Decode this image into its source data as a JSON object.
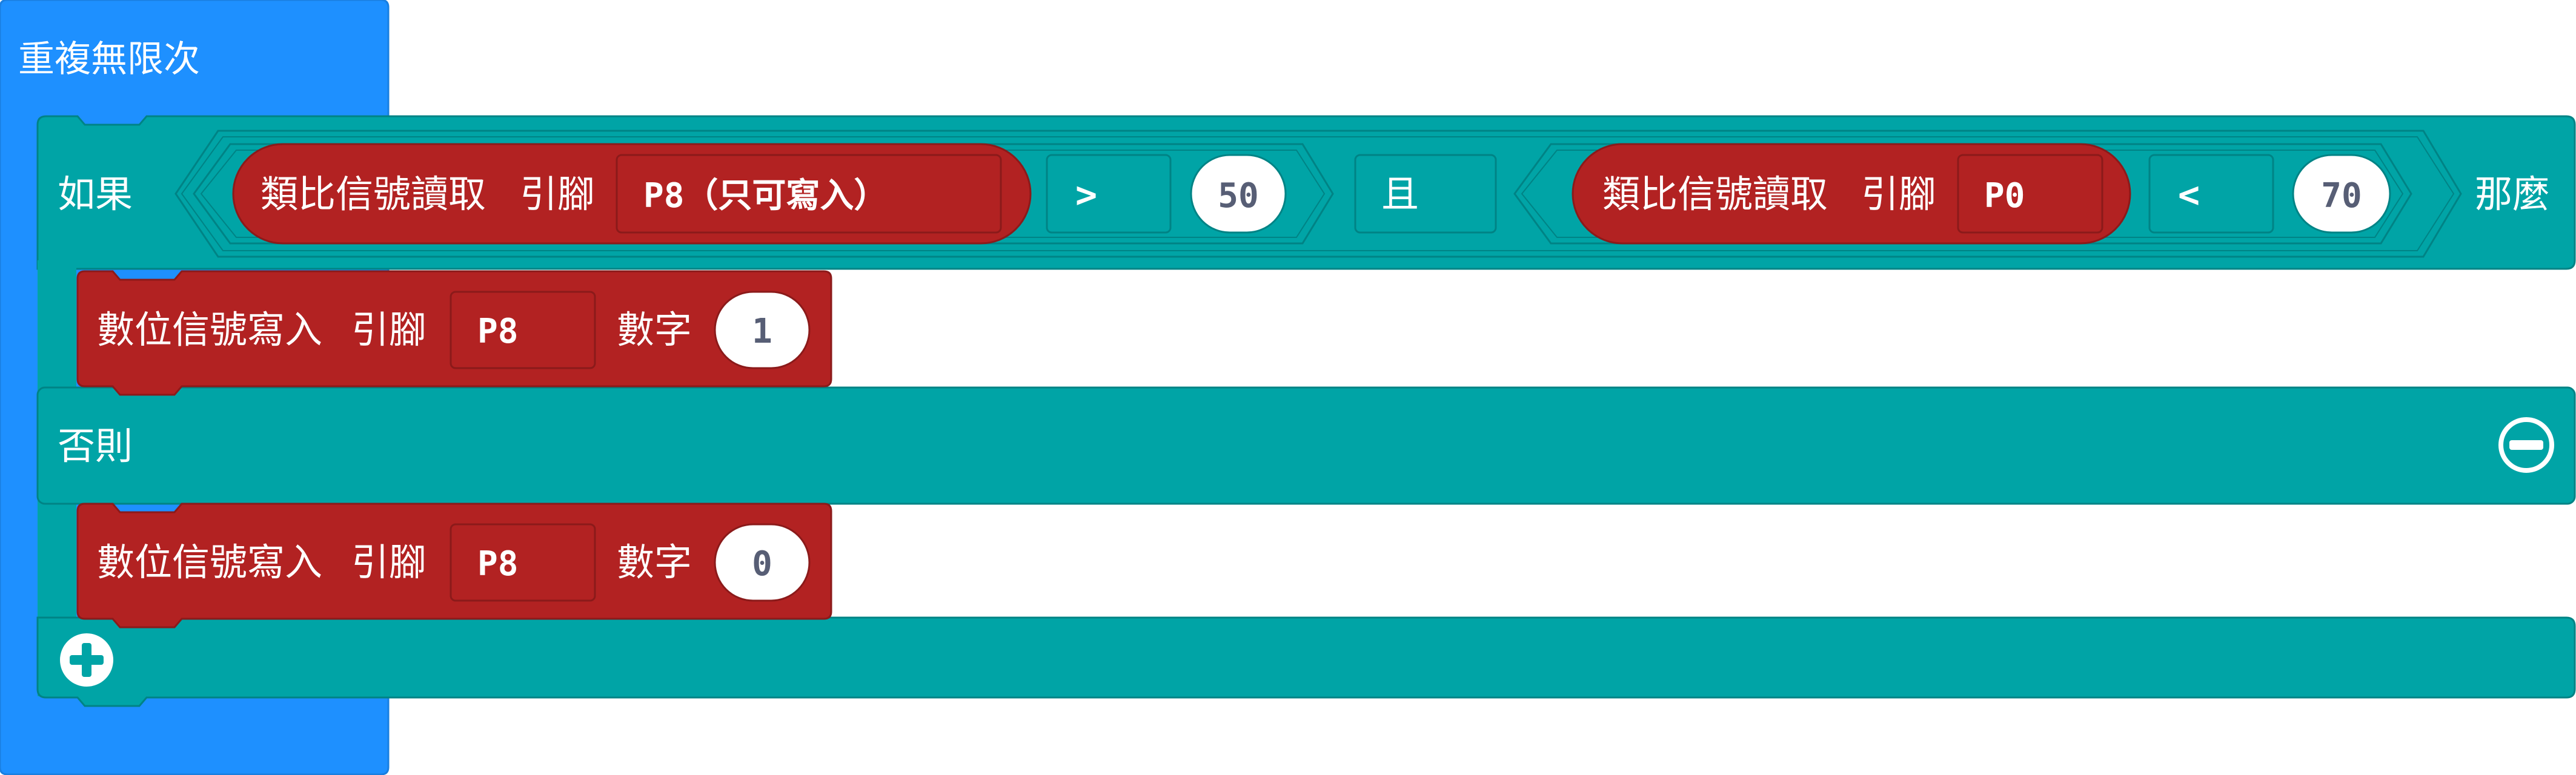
{
  "forever_block": {
    "label": "重複無限次"
  },
  "if_block": {
    "if_label": "如果",
    "then_label": "那麼",
    "else_label": "否則",
    "remove_icon": "minus-circle-icon",
    "add_icon": "plus-circle-icon"
  },
  "condition": {
    "left": {
      "read_label": "類比信號讀取",
      "pin_label": "引腳",
      "pin_value": "P8（只可寫入）",
      "operator": ">",
      "compare_value": "50"
    },
    "logic_operator": "且",
    "right": {
      "read_label": "類比信號讀取",
      "pin_label": "引腳",
      "pin_value": "P0",
      "operator": "<",
      "compare_value": "70"
    }
  },
  "then_statement": {
    "write_label": "數位信號寫入",
    "pin_label": "引腳",
    "pin_value": "P8",
    "number_label": "數字",
    "number_value": "1"
  },
  "else_statement": {
    "write_label": "數位信號寫入",
    "pin_label": "引腳",
    "pin_value": "P8",
    "number_label": "數字",
    "number_value": "0"
  },
  "colors": {
    "loop": "#1E90FF",
    "logic": "#00A4A6",
    "logic_dark": "#008385",
    "pins": "#B22222",
    "pins_dark": "#8B1A1A",
    "field_text": "#575E75"
  }
}
